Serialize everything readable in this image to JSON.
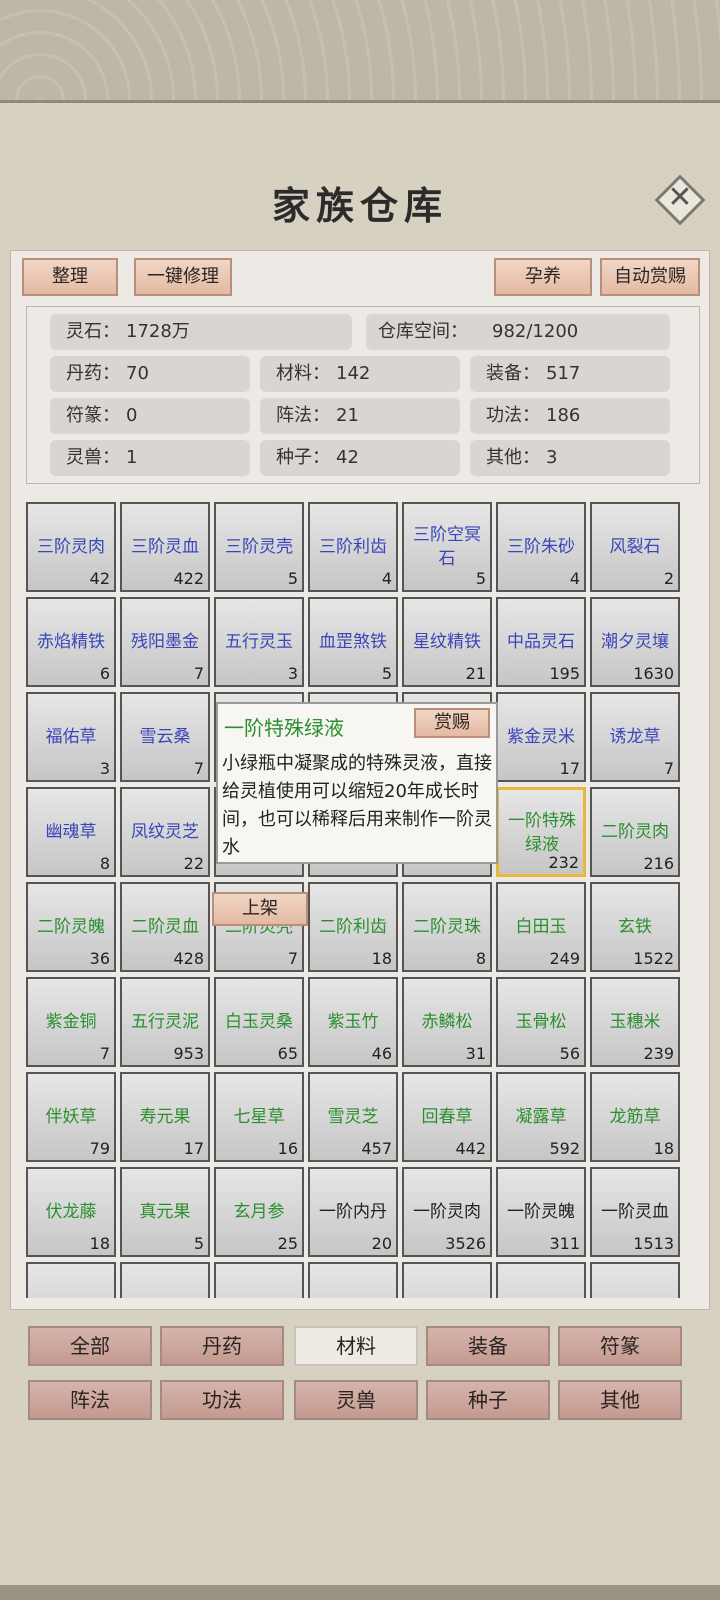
{
  "title": "家族仓库",
  "toolbar": {
    "sort": "整理",
    "repair_all": "一键修理",
    "nurture": "孕养",
    "auto_reward": "自动赏赐"
  },
  "stats": {
    "spirit_stone": {
      "label": "灵石：",
      "value": "1728万"
    },
    "capacity": {
      "label": "仓库空间：",
      "value": "982/1200"
    },
    "pill": {
      "label": "丹药：",
      "value": "70"
    },
    "material": {
      "label": "材料：",
      "value": "142"
    },
    "equipment": {
      "label": "装备：",
      "value": "517"
    },
    "talisman": {
      "label": "符篆：",
      "value": "0"
    },
    "formation": {
      "label": "阵法：",
      "value": "21"
    },
    "technique": {
      "label": "功法：",
      "value": "186"
    },
    "beast": {
      "label": "灵兽：",
      "value": "1"
    },
    "seed": {
      "label": "种子：",
      "value": "42"
    },
    "other": {
      "label": "其他：",
      "value": "3"
    }
  },
  "items": [
    {
      "name": "三阶灵肉",
      "count": "42",
      "color": "blue"
    },
    {
      "name": "三阶灵血",
      "count": "422",
      "color": "blue"
    },
    {
      "name": "三阶灵壳",
      "count": "5",
      "color": "blue"
    },
    {
      "name": "三阶利齿",
      "count": "4",
      "color": "blue"
    },
    {
      "name": "三阶空冥石",
      "count": "5",
      "color": "blue"
    },
    {
      "name": "三阶朱砂",
      "count": "4",
      "color": "blue"
    },
    {
      "name": "风裂石",
      "count": "2",
      "color": "blue"
    },
    {
      "name": "赤焰精铁",
      "count": "6",
      "color": "blue"
    },
    {
      "name": "残阳墨金",
      "count": "7",
      "color": "blue"
    },
    {
      "name": "五行灵玉",
      "count": "3",
      "color": "blue"
    },
    {
      "name": "血罡煞铁",
      "count": "5",
      "color": "blue"
    },
    {
      "name": "星纹精铁",
      "count": "21",
      "color": "blue"
    },
    {
      "name": "中品灵石",
      "count": "195",
      "color": "blue"
    },
    {
      "name": "潮夕灵壤",
      "count": "1630",
      "color": "blue"
    },
    {
      "name": "福佑草",
      "count": "3",
      "color": "blue"
    },
    {
      "name": "雪云桑",
      "count": "7",
      "color": "blue"
    },
    {
      "name": "",
      "count": "",
      "color": "blue"
    },
    {
      "name": "",
      "count": "",
      "color": "blue"
    },
    {
      "name": "",
      "count": "",
      "color": "blue"
    },
    {
      "name": "紫金灵米",
      "count": "17",
      "color": "blue"
    },
    {
      "name": "诱龙草",
      "count": "7",
      "color": "blue"
    },
    {
      "name": "幽魂草",
      "count": "8",
      "color": "blue"
    },
    {
      "name": "凤纹灵芝",
      "count": "22",
      "color": "blue"
    },
    {
      "name": "",
      "count": "",
      "color": "blue"
    },
    {
      "name": "",
      "count": "",
      "color": "blue"
    },
    {
      "name": "",
      "count": "",
      "color": "blue"
    },
    {
      "name": "一阶特殊绿液",
      "count": "232",
      "color": "green",
      "selected": true
    },
    {
      "name": "二阶灵肉",
      "count": "216",
      "color": "green"
    },
    {
      "name": "二阶灵魄",
      "count": "36",
      "color": "green"
    },
    {
      "name": "二阶灵血",
      "count": "428",
      "color": "green"
    },
    {
      "name": "二阶灵壳",
      "count": "7",
      "color": "green"
    },
    {
      "name": "二阶利齿",
      "count": "18",
      "color": "green"
    },
    {
      "name": "二阶灵珠",
      "count": "8",
      "color": "green"
    },
    {
      "name": "白田玉",
      "count": "249",
      "color": "green"
    },
    {
      "name": "玄铁",
      "count": "1522",
      "color": "green"
    },
    {
      "name": "紫金铜",
      "count": "7",
      "color": "green"
    },
    {
      "name": "五行灵泥",
      "count": "953",
      "color": "green"
    },
    {
      "name": "白玉灵桑",
      "count": "65",
      "color": "green"
    },
    {
      "name": "紫玉竹",
      "count": "46",
      "color": "green"
    },
    {
      "name": "赤鳞松",
      "count": "31",
      "color": "green"
    },
    {
      "name": "玉骨松",
      "count": "56",
      "color": "green"
    },
    {
      "name": "玉穗米",
      "count": "239",
      "color": "green"
    },
    {
      "name": "伴妖草",
      "count": "79",
      "color": "green"
    },
    {
      "name": "寿元果",
      "count": "17",
      "color": "green"
    },
    {
      "name": "七星草",
      "count": "16",
      "color": "green"
    },
    {
      "name": "雪灵芝",
      "count": "457",
      "color": "green"
    },
    {
      "name": "回春草",
      "count": "442",
      "color": "green"
    },
    {
      "name": "凝露草",
      "count": "592",
      "color": "green"
    },
    {
      "name": "龙筋草",
      "count": "18",
      "color": "green"
    },
    {
      "name": "伏龙藤",
      "count": "18",
      "color": "green"
    },
    {
      "name": "真元果",
      "count": "5",
      "color": "green"
    },
    {
      "name": "玄月参",
      "count": "25",
      "color": "green"
    },
    {
      "name": "一阶内丹",
      "count": "20",
      "color": "black"
    },
    {
      "name": "一阶灵肉",
      "count": "3526",
      "color": "black"
    },
    {
      "name": "一阶灵魄",
      "count": "311",
      "color": "black"
    },
    {
      "name": "一阶灵血",
      "count": "1513",
      "color": "black"
    },
    {
      "name": "",
      "count": "",
      "color": "black"
    },
    {
      "name": "",
      "count": "",
      "color": "black"
    },
    {
      "name": "",
      "count": "",
      "color": "black"
    },
    {
      "name": "",
      "count": "",
      "color": "black"
    },
    {
      "name": "",
      "count": "",
      "color": "black"
    },
    {
      "name": "",
      "count": "",
      "color": "black"
    },
    {
      "name": "",
      "count": "",
      "color": "black"
    }
  ],
  "popup": {
    "name": "一阶特殊绿液",
    "reward_btn": "赏赐",
    "desc": "小绿瓶中凝聚成的特殊灵液，直接给灵植使用可以缩短20年成长时间，也可以稀释后用来制作一阶灵水",
    "list_btn": "上架"
  },
  "tabs": [
    "全部",
    "丹药",
    "材料",
    "装备",
    "符篆",
    "阵法",
    "功法",
    "灵兽",
    "种子",
    "其他"
  ],
  "active_tab": "材料",
  "colors": {
    "blue": "#3a46b8",
    "green": "#2b8f2e",
    "selected_border": "#e6b83c",
    "button": "#e4b9a2"
  }
}
